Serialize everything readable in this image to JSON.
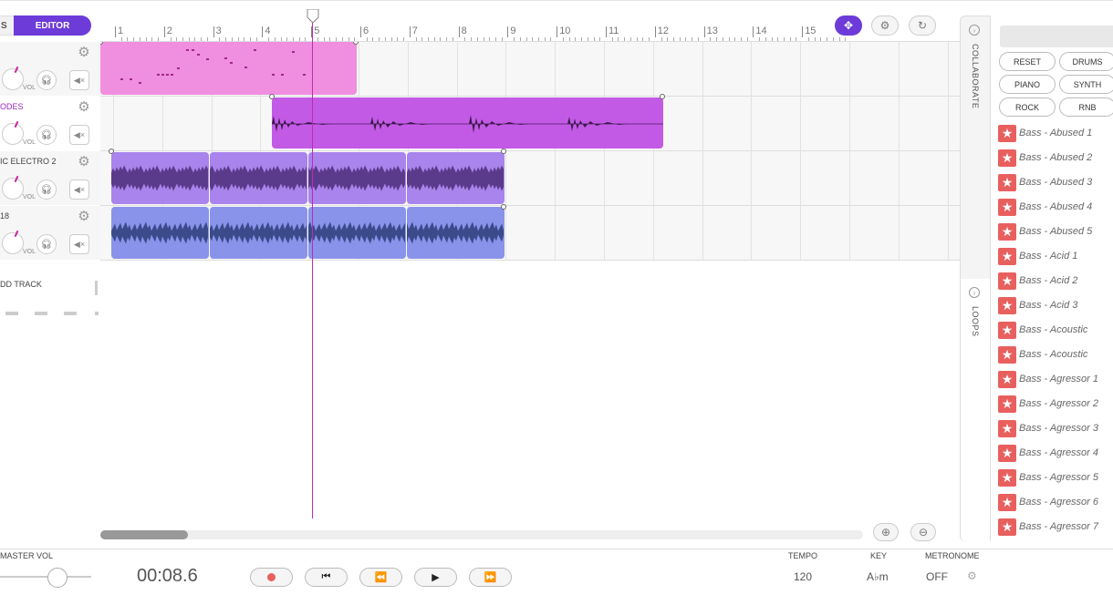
{
  "mode_tabs": {
    "tracks_label": "S",
    "editor_label": "EDITOR"
  },
  "tracks": [
    {
      "name": "",
      "color": "#f08ee0",
      "active": false
    },
    {
      "name": "ODES",
      "color": "#c35ae6",
      "active": true
    },
    {
      "name": "IC ELECTRO 2",
      "color": "#a884ec",
      "active": false
    },
    {
      "name": "18",
      "color": "#8a93ea",
      "active": false
    }
  ],
  "track_controls": {
    "vol_label": "VOL"
  },
  "add_track_label": "DD TRACK",
  "ruler": {
    "bars": [
      "1",
      "2",
      "3",
      "4",
      "5",
      "6",
      "7",
      "8",
      "9",
      "10",
      "11",
      "12",
      "13",
      "14",
      "15"
    ]
  },
  "playhead_bar": 5,
  "side_tabs": {
    "collaborate": "COLLABORATE",
    "loops": "LOOPS"
  },
  "genres": [
    "RESET",
    "DRUMS",
    "PIANO",
    "SYNTH",
    "ROCK",
    "RNB"
  ],
  "loops": [
    "Bass - Abused 1",
    "Bass - Abused 2",
    "Bass - Abused 3",
    "Bass - Abused 4",
    "Bass - Abused 5",
    "Bass - Acid 1",
    "Bass - Acid 2",
    "Bass - Acid 3",
    "Bass - Acoustic",
    "Bass - Acoustic",
    "Bass - Agressor 1",
    "Bass - Agressor 2",
    "Bass - Agressor 3",
    "Bass - Agressor 4",
    "Bass - Agressor 5",
    "Bass - Agressor 6",
    "Bass - Agressor 7"
  ],
  "footer": {
    "master_vol_label": "MASTER VOL",
    "time": "00:08.6",
    "tempo_label": "TEMPO",
    "tempo_value": "120",
    "key_label": "KEY",
    "key_value": "A♭m",
    "metronome_label": "METRONOME",
    "metronome_value": "OFF"
  },
  "icons": {
    "gear": "gear-icon",
    "headphones": "headphones-icon",
    "mute": "mute-icon",
    "snap": "snap-icon",
    "loop": "loop-icon",
    "zoom_in": "zoom-in-icon",
    "zoom_out": "zoom-out-icon",
    "star": "star-icon",
    "record": "record-icon"
  },
  "colors": {
    "accent": "#6c3bd8",
    "playhead": "#c02ab0",
    "star": "#e8605e"
  }
}
